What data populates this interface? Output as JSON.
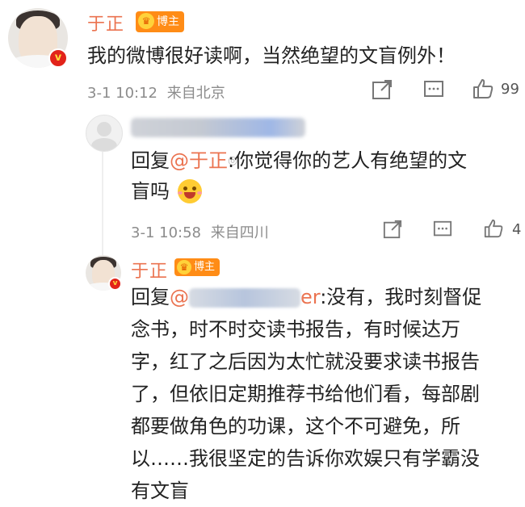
{
  "post": {
    "author": "于正",
    "badge": "博主",
    "avatar_badge": "v",
    "text": "我的微博很好读啊，当然绝望的文盲例外！",
    "time": "3-1 10:12",
    "location": "来自北京",
    "likes": "99"
  },
  "reply1": {
    "prefix": "回复",
    "mention": "@于正",
    "text1": ":你觉得你的艺人有绝望的文",
    "text2": "盲吗",
    "time": "3-1 10:58",
    "location": "来自四川",
    "likes": "4"
  },
  "reply2": {
    "author": "于正",
    "badge": "博主",
    "avatar_badge": "v",
    "prefix": "回复",
    "mention_start": "@",
    "mention_end": "er",
    "lines": [
      ":没有，我时刻督促",
      "念书，时不时交读书报告，有时候达万",
      "字，红了之后因为太忙就没要求读书报告",
      "了，但依旧定期推荐书给他们看，每部剧",
      "都要做角色的功课，这个不可避免，所",
      "以……我很坚定的告诉你欢娱只有学霸没",
      "有文盲"
    ]
  },
  "icons": {
    "share": "share-icon",
    "comment": "comment-icon",
    "like": "thumbs-up-icon"
  },
  "colors": {
    "name": "#eb7350",
    "badge": "#ff8c16",
    "meta": "#8c8c8c",
    "verified": "#e2231a"
  }
}
